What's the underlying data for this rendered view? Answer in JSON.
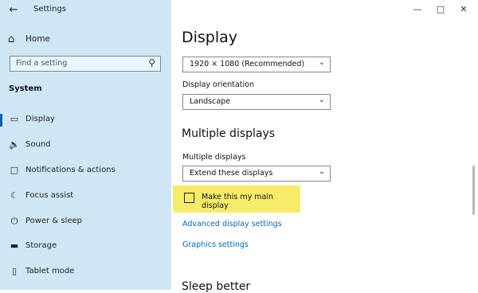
{
  "window": {
    "title": "Settings"
  },
  "sidebar": {
    "home_label": "Home",
    "search_placeholder": "Find a setting",
    "section_title": "System",
    "items": [
      {
        "label": "Display",
        "icon": "monitor-icon",
        "active": true
      },
      {
        "label": "Sound",
        "icon": "speaker-icon"
      },
      {
        "label": "Notifications & actions",
        "icon": "notification-icon"
      },
      {
        "label": "Focus assist",
        "icon": "moon-icon"
      },
      {
        "label": "Power & sleep",
        "icon": "power-icon"
      },
      {
        "label": "Storage",
        "icon": "storage-icon"
      },
      {
        "label": "Tablet mode",
        "icon": "tablet-icon"
      }
    ]
  },
  "main": {
    "title": "Display",
    "resolution_value": "1920 × 1080 (Recommended)",
    "orientation_label": "Display orientation",
    "orientation_value": "Landscape",
    "multiple_heading": "Multiple displays",
    "multiple_label": "Multiple displays",
    "multiple_value": "Extend these displays",
    "main_display_checkbox_label": "Make this my main display",
    "main_display_checked": false,
    "advanced_link": "Advanced display settings",
    "graphics_link": "Graphics settings",
    "next_heading": "Sleep better"
  },
  "colors": {
    "sidebar_bg": "#cfe6f4",
    "accent": "#0063b1",
    "link": "#0067b8",
    "highlight": "#f7ec6a"
  }
}
